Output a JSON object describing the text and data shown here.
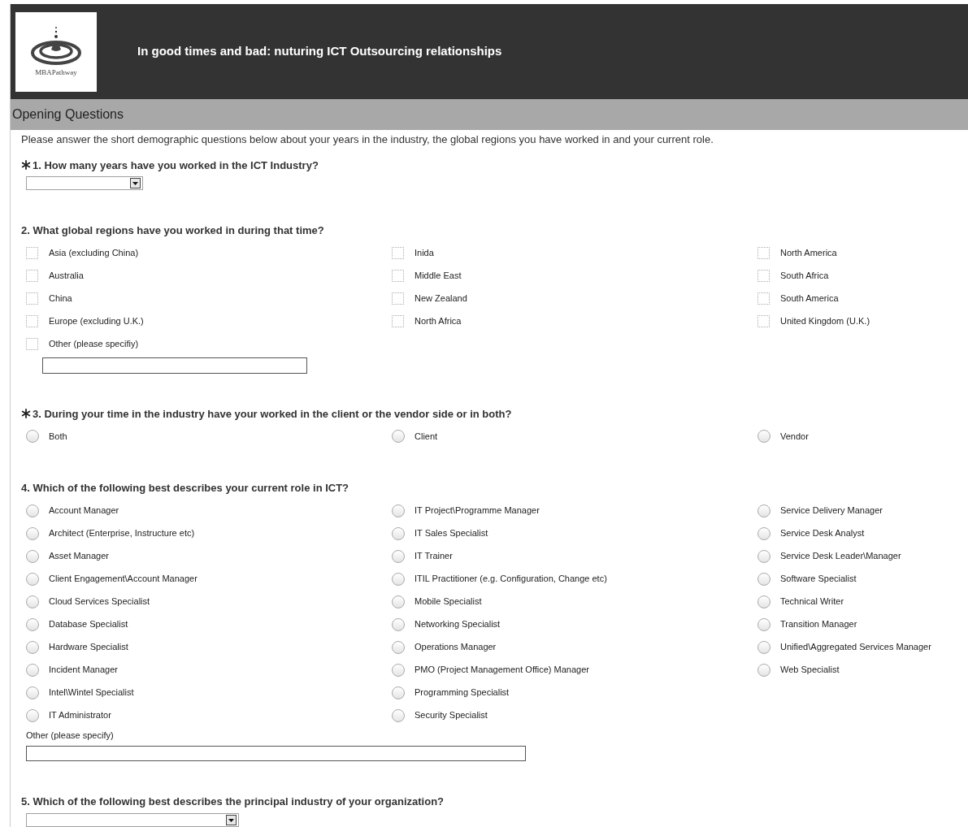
{
  "header": {
    "logo_text": "MBAPathway",
    "title": "In good times and bad: nuturing ICT Outsourcing relationships"
  },
  "section": {
    "title": "Opening Questions"
  },
  "intro": "Please answer the short demographic questions below about your years in the industry, the global regions you have worked in and your current role.",
  "questions": [
    {
      "kind": "dropdown",
      "required": true,
      "number": "1.",
      "text": "How many years have you worked in the ICT Industry?"
    },
    {
      "kind": "checkboxes",
      "required": false,
      "number": "2.",
      "text": "What global regions have you worked in during that time?",
      "columns": [
        [
          {
            "label": "Asia (excluding China)",
            "checked": false
          },
          {
            "label": "Australia",
            "checked": false
          },
          {
            "label": "China",
            "checked": false
          },
          {
            "label": "Europe (excluding U.K.)",
            "checked": false
          },
          {
            "label": "Other (please specifiy)",
            "checked": false
          }
        ],
        [
          {
            "label": "Inida",
            "checked": false
          },
          {
            "label": "Middle East",
            "checked": false
          },
          {
            "label": "New Zealand",
            "checked": false
          },
          {
            "label": "North Africa",
            "checked": false
          }
        ],
        [
          {
            "label": "North America",
            "checked": false
          },
          {
            "label": "South Africa",
            "checked": false
          },
          {
            "label": "South America",
            "checked": false
          },
          {
            "label": "United Kingdom (U.K.)",
            "checked": false
          }
        ]
      ],
      "other": {
        "kind": "indented"
      }
    },
    {
      "kind": "radios",
      "required": true,
      "number": "3.",
      "text": "During your time in the industry have your worked in the client or the vendor side or in both?",
      "columns": [
        [
          {
            "label": "Both",
            "selected": false
          }
        ],
        [
          {
            "label": "Client",
            "selected": false
          }
        ],
        [
          {
            "label": "Vendor",
            "selected": false
          }
        ]
      ]
    },
    {
      "kind": "radios",
      "required": false,
      "number": "4.",
      "text": "Which of the following best describes your current role in ICT?",
      "columns": [
        [
          {
            "label": "Account Manager",
            "selected": false
          },
          {
            "label": "Architect (Enterprise, Instructure etc)",
            "selected": false
          },
          {
            "label": "Asset Manager",
            "selected": false
          },
          {
            "label": "Client Engagement\\Account Manager",
            "selected": false
          },
          {
            "label": "Cloud Services Specialist",
            "selected": false
          },
          {
            "label": "Database Specialist",
            "selected": false
          },
          {
            "label": "Hardware Specialist",
            "selected": false
          },
          {
            "label": "Incident Manager",
            "selected": false
          },
          {
            "label": "Intel\\Wintel Specialist",
            "selected": false
          },
          {
            "label": "IT Administrator",
            "selected": false
          }
        ],
        [
          {
            "label": "IT Project\\Programme Manager",
            "selected": false
          },
          {
            "label": "IT Sales Specialist",
            "selected": false
          },
          {
            "label": "IT Trainer",
            "selected": false
          },
          {
            "label": "ITIL Practitioner (e.g. Configuration, Change etc)",
            "selected": false
          },
          {
            "label": "Mobile Specialist",
            "selected": false
          },
          {
            "label": "Networking Specialist",
            "selected": false
          },
          {
            "label": "Operations Manager",
            "selected": false
          },
          {
            "label": "PMO (Project Management Office) Manager",
            "selected": false
          },
          {
            "label": "Programming Specialist",
            "selected": false
          },
          {
            "label": "Security Specialist",
            "selected": false
          }
        ],
        [
          {
            "label": "Service Delivery Manager",
            "selected": false
          },
          {
            "label": "Service Desk Analyst",
            "selected": false
          },
          {
            "label": "Service Desk Leader\\Manager",
            "selected": false
          },
          {
            "label": "Software Specialist",
            "selected": false
          },
          {
            "label": "Technical Writer",
            "selected": false
          },
          {
            "label": "Transition Manager",
            "selected": false
          },
          {
            "label": "Unified\\Aggregated Services Manager",
            "selected": false
          },
          {
            "label": "Web Specialist",
            "selected": false
          }
        ]
      ],
      "other": {
        "kind": "labelled",
        "label": "Other (please specify)"
      }
    },
    {
      "kind": "dropdown",
      "required": false,
      "number": "5.",
      "text": "Which of the following best describes the principal industry of your organization?"
    }
  ]
}
